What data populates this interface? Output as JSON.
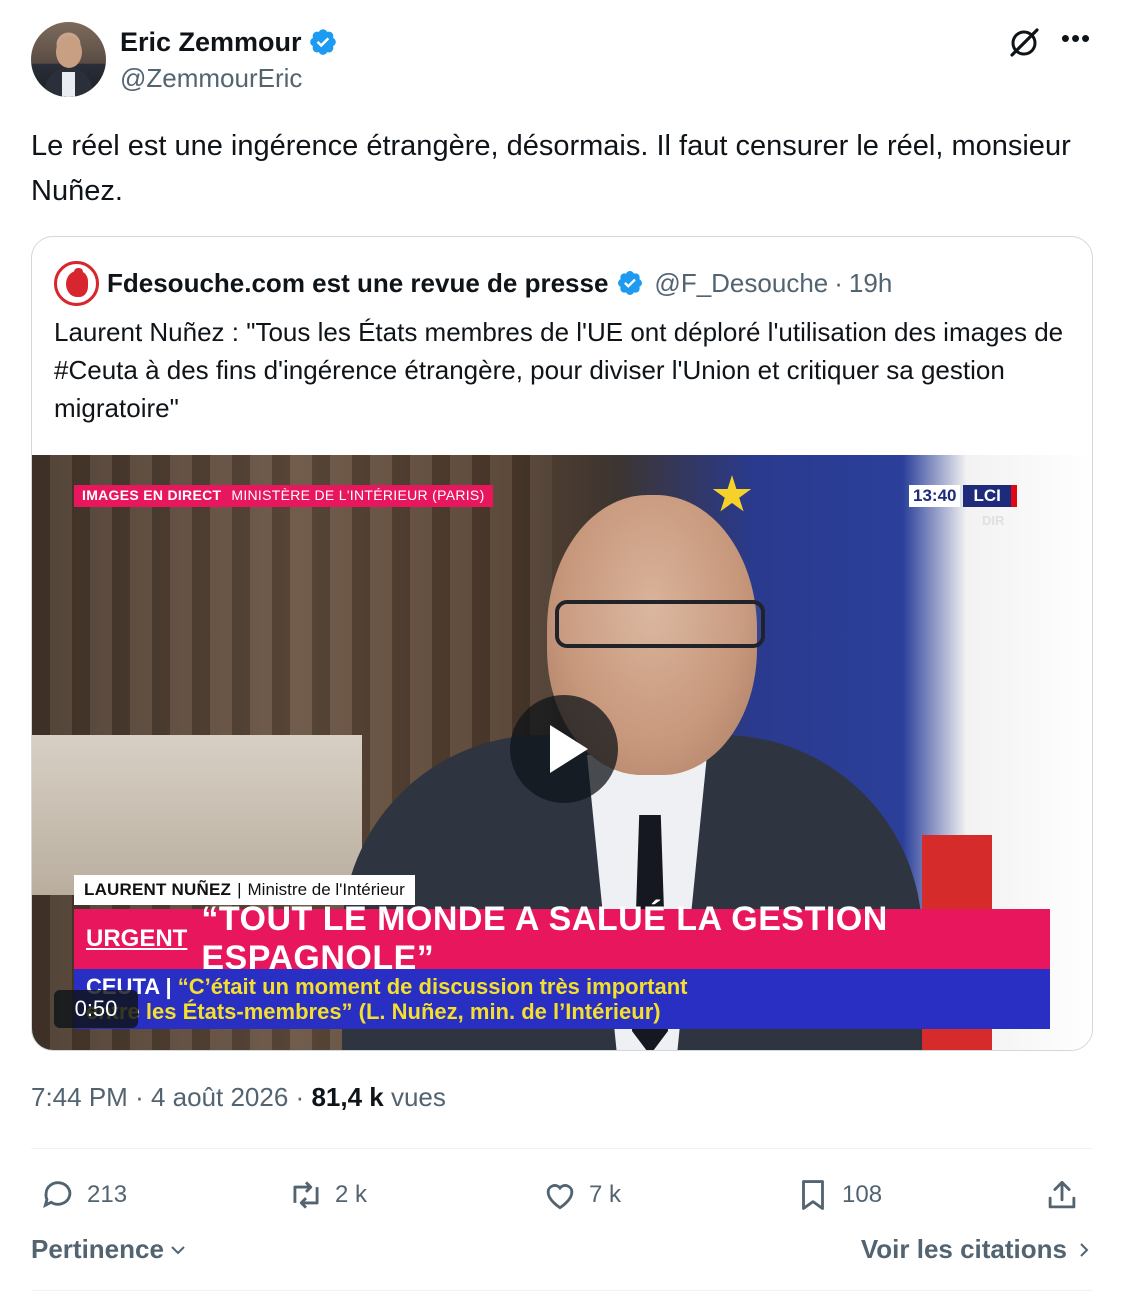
{
  "tweet": {
    "author_name": "Eric Zemmour",
    "author_handle": "@ZemmourEric",
    "text": "Le réel est une ingérence étrangère, désormais. Il faut censurer le réel, monsieur Nuñez.",
    "time": "7:44 PM",
    "date": "4 août 2026",
    "views_count": "81,4 k",
    "views_label": "vues"
  },
  "quote": {
    "author_name": "Fdesouche.com est une revue de presse",
    "author_handle": "@F_Desouche",
    "age": "19h",
    "text": "Laurent Nuñez : \"Tous les États membres de l'UE ont déploré l'utilisation des images de #Ceuta à des fins d'ingérence étrangère, pour diviser l'Union et critiquer sa gestion migratoire\"",
    "video": {
      "live_tag": "IMAGES EN DIRECT",
      "live_location": "MINISTÈRE DE L'INTÉRIEUR (PARIS)",
      "clock": "13:40",
      "channel": "LCI",
      "channel_sub": "DIR",
      "person_name": "LAURENT NUÑEZ",
      "person_title": "Ministre de l'Intérieur",
      "urgent_label": "URGENT",
      "headline": "“TOUT LE MONDE A SALUÉ LA GESTION ESPAGNOLE”",
      "ticker_place": "CEUTA",
      "ticker_line1": "“C’était un moment de discussion très important",
      "ticker_line2": "entre les États-membres” (L. Nuñez, min. de l’Intérieur)",
      "duration": "0:50"
    }
  },
  "actions": {
    "replies": "213",
    "reposts": "2 k",
    "likes": "7 k",
    "bookmarks": "108"
  },
  "footer": {
    "sort_label": "Pertinence",
    "quotes_link": "Voir les citations"
  },
  "colors": {
    "verified": "#1d9bf0",
    "muted": "#536471",
    "text": "#0f1419",
    "lci_pink": "#e8175d",
    "ticker_blue": "#2a2fc4"
  },
  "icons": [
    "verified-badge-icon",
    "grok-icon",
    "more-icon",
    "play-icon",
    "reply-icon",
    "repost-icon",
    "like-icon",
    "bookmark-icon",
    "share-icon",
    "chevron-down-icon",
    "chevron-right-icon"
  ]
}
